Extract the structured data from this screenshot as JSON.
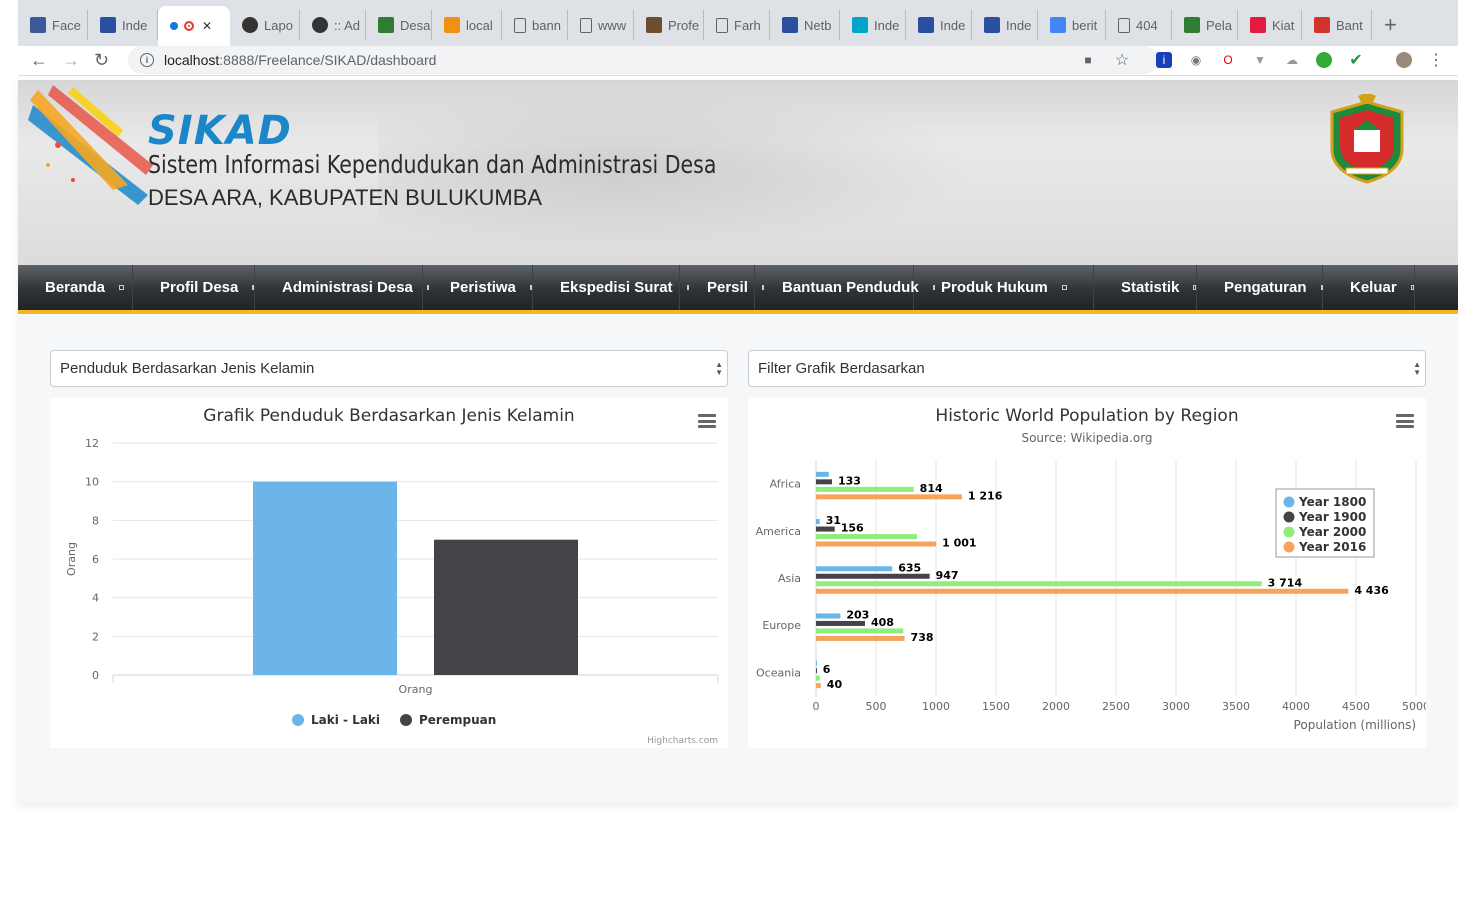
{
  "browser": {
    "tabs": [
      {
        "label": "Face",
        "icon": "facebook-icon",
        "color": "#3b5998"
      },
      {
        "label": "Inde",
        "icon": "n-logo-icon",
        "color": "#2b4fa0"
      },
      {
        "label": "",
        "icon": "recording-icon",
        "color": "#1a73e8",
        "active": true
      },
      {
        "label": "Lapo",
        "icon": "github-icon",
        "color": "#333333"
      },
      {
        "label": ":: Ad",
        "icon": "github-icon",
        "color": "#333333"
      },
      {
        "label": "Desa",
        "icon": "emblem-icon",
        "color": "#2e7d32"
      },
      {
        "label": "local",
        "icon": "pma-icon",
        "color": "#f29111"
      },
      {
        "label": "bann",
        "icon": "page-icon",
        "color": "#5f6368"
      },
      {
        "label": "www",
        "icon": "page-icon",
        "color": "#5f6368"
      },
      {
        "label": "Profe",
        "icon": "photo-icon",
        "color": "#6d4c2f"
      },
      {
        "label": "Farh",
        "icon": "page-icon",
        "color": "#5f6368"
      },
      {
        "label": "Netb",
        "icon": "n-logo-icon",
        "color": "#2b4fa0"
      },
      {
        "label": "Inde",
        "icon": "n-logo-icon",
        "color": "#00a6c7"
      },
      {
        "label": "Inde",
        "icon": "n-logo-icon",
        "color": "#2b4fa0"
      },
      {
        "label": "Inde",
        "icon": "n-logo-icon",
        "color": "#2b4fa0"
      },
      {
        "label": "berit",
        "icon": "google-icon",
        "color": "#4285f4"
      },
      {
        "label": "404",
        "icon": "page-icon",
        "color": "#5f6368"
      },
      {
        "label": "Pela",
        "icon": "emblem-icon",
        "color": "#2e7d32"
      },
      {
        "label": "Kiat",
        "icon": "r-logo-icon",
        "color": "#e31c3d"
      },
      {
        "label": "Bant",
        "icon": "share-icon",
        "color": "#d0342c"
      }
    ],
    "new_tab": "+",
    "url_host": "localhost",
    "url_path": ":8888/Freelance/SIKAD/dashboard"
  },
  "header": {
    "logo": "SIKAD",
    "title": "Sistem Informasi Kependudukan dan Administrasi Desa",
    "subtitle": "DESA ARA, KABUPATEN BULUKUMBA"
  },
  "menu": [
    {
      "label": "Beranda"
    },
    {
      "label": "Profil Desa"
    },
    {
      "label": "Administrasi Desa"
    },
    {
      "label": "Peristiwa"
    },
    {
      "label": "Ekspedisi Surat"
    },
    {
      "label": "Persil"
    },
    {
      "label": "Bantuan Penduduk"
    },
    {
      "label": "Produk Hukum"
    },
    {
      "label": "Statistik"
    },
    {
      "label": "Pengaturan"
    },
    {
      "label": "Keluar"
    }
  ],
  "filters": {
    "left_selected": "Penduduk Berdasarkan Jenis Kelamin",
    "right_selected": "Filter Grafik Berdasarkan"
  },
  "credits": "Highcharts.com",
  "chart_data": [
    {
      "type": "bar",
      "title": "Grafik Penduduk Berdasarkan Jenis Kelamin",
      "xlabel": "",
      "ylabel": "Orang",
      "categories": [
        "Orang"
      ],
      "ylim": [
        0,
        12
      ],
      "yticks": [
        0,
        2,
        4,
        6,
        8,
        10,
        12
      ],
      "grid": true,
      "legend_position": "bottom",
      "series": [
        {
          "name": "Laki - Laki",
          "values": [
            10
          ],
          "color": "#6cb5e8"
        },
        {
          "name": "Perempuan",
          "values": [
            7
          ],
          "color": "#434348"
        }
      ]
    },
    {
      "type": "bar",
      "orientation": "horizontal",
      "title": "Historic World Population by Region",
      "subtitle": "Source: Wikipedia.org",
      "xlabel": "Population (millions)",
      "categories": [
        "Africa",
        "America",
        "Asia",
        "Europe",
        "Oceania"
      ],
      "xlim": [
        0,
        5000
      ],
      "xticks": [
        0,
        500,
        1000,
        1500,
        2000,
        2500,
        3000,
        3500,
        4000,
        4500,
        5000
      ],
      "grid": true,
      "legend_position": "top-right",
      "series": [
        {
          "name": "Year 1800",
          "values": [
            107,
            31,
            635,
            203,
            2
          ],
          "labels": [
            "",
            "31",
            "635",
            "203",
            ""
          ],
          "color": "#6cb5e8"
        },
        {
          "name": "Year 1900",
          "values": [
            133,
            156,
            947,
            408,
            6
          ],
          "labels": [
            "133",
            "156",
            "947",
            "408",
            "6"
          ],
          "color": "#434348"
        },
        {
          "name": "Year 2000",
          "values": [
            814,
            841,
            3714,
            727,
            31
          ],
          "labels": [
            "814",
            "",
            "3 714",
            "",
            ""
          ],
          "color": "#90ed7d"
        },
        {
          "name": "Year 2016",
          "values": [
            1216,
            1001,
            4436,
            738,
            40
          ],
          "labels": [
            "1 216",
            "1 001",
            "4 436",
            "738",
            "40"
          ],
          "color": "#f7a35c"
        }
      ]
    }
  ]
}
